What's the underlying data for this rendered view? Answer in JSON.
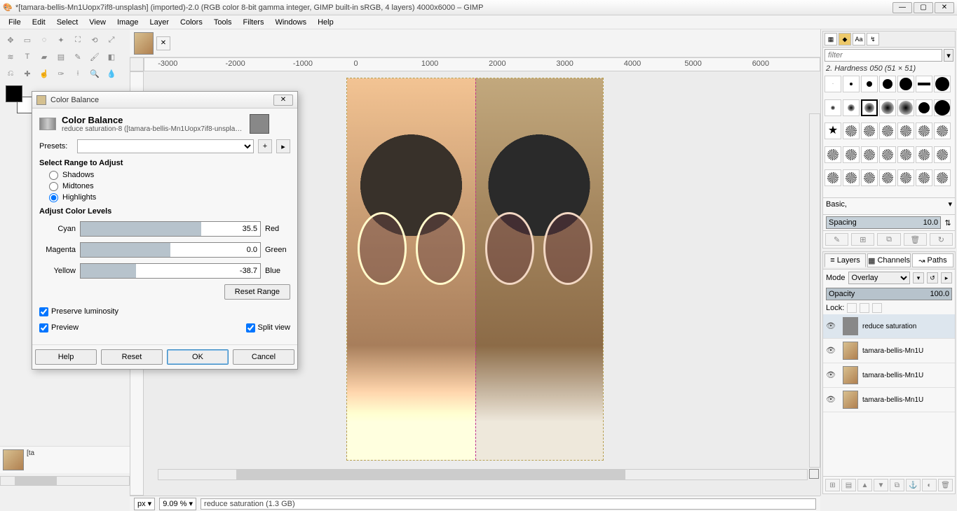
{
  "titlebar": {
    "title": "*[tamara-bellis-Mn1Uopx7if8-unsplash] (imported)-2.0 (RGB color 8-bit gamma integer, GIMP built-in sRGB, 4 layers) 4000x6000 – GIMP",
    "min": "—",
    "max": "▢",
    "close": "✕"
  },
  "menu": [
    "File",
    "Edit",
    "Select",
    "View",
    "Image",
    "Layer",
    "Colors",
    "Tools",
    "Filters",
    "Windows",
    "Help"
  ],
  "dialog": {
    "title": "Color Balance",
    "heading": "Color Balance",
    "subheading": "reduce saturation-8 ([tamara-bellis-Mn1Uopx7if8-unsplash] (impor...",
    "presets_label": "Presets:",
    "range_label": "Select Range to Adjust",
    "ranges": {
      "shadows": "Shadows",
      "midtones": "Midtones",
      "highlights": "Highlights"
    },
    "selected_range": "highlights",
    "levels_label": "Adjust Color Levels",
    "sliders": [
      {
        "left": "Cyan",
        "right": "Red",
        "value": "35.5",
        "fill_left": 0,
        "fill_width": 67
      },
      {
        "left": "Magenta",
        "right": "Green",
        "value": "0.0",
        "fill_left": 0,
        "fill_width": 50
      },
      {
        "left": "Yellow",
        "right": "Blue",
        "value": "-38.7",
        "fill_left": 0,
        "fill_width": 31
      }
    ],
    "reset_range": "Reset Range",
    "preserve": "Preserve luminosity",
    "preview": "Preview",
    "split": "Split view",
    "help": "Help",
    "reset": "Reset",
    "ok": "OK",
    "cancel": "Cancel"
  },
  "ruler_ticks": [
    "-3000",
    "-2000",
    "-1000",
    "0",
    "1000",
    "2000",
    "3000",
    "4000",
    "5000",
    "6000"
  ],
  "brushes": {
    "filter_ph": "filter",
    "selected_name": "2. Hardness 050 (51 × 51)",
    "preset_label": "Basic,",
    "spacing_label": "Spacing",
    "spacing_value": "10.0"
  },
  "layers_panel": {
    "tabs": [
      "Layers",
      "Channels",
      "Paths"
    ],
    "mode_label": "Mode",
    "mode_value": "Overlay",
    "opacity_label": "Opacity",
    "opacity_value": "100.0",
    "lock_label": "Lock:",
    "layers": [
      {
        "name": "reduce saturation",
        "gray": true,
        "active": true
      },
      {
        "name": "tamara-bellis-Mn1U",
        "gray": false,
        "active": false
      },
      {
        "name": "tamara-bellis-Mn1U",
        "gray": false,
        "active": false
      },
      {
        "name": "tamara-bellis-Mn1U",
        "gray": false,
        "active": false
      }
    ]
  },
  "status": {
    "unit": "px ▾",
    "zoom": "9.09 % ▾",
    "info": "reduce saturation (1.3 GB)"
  },
  "imgstrip_label": "[ta"
}
